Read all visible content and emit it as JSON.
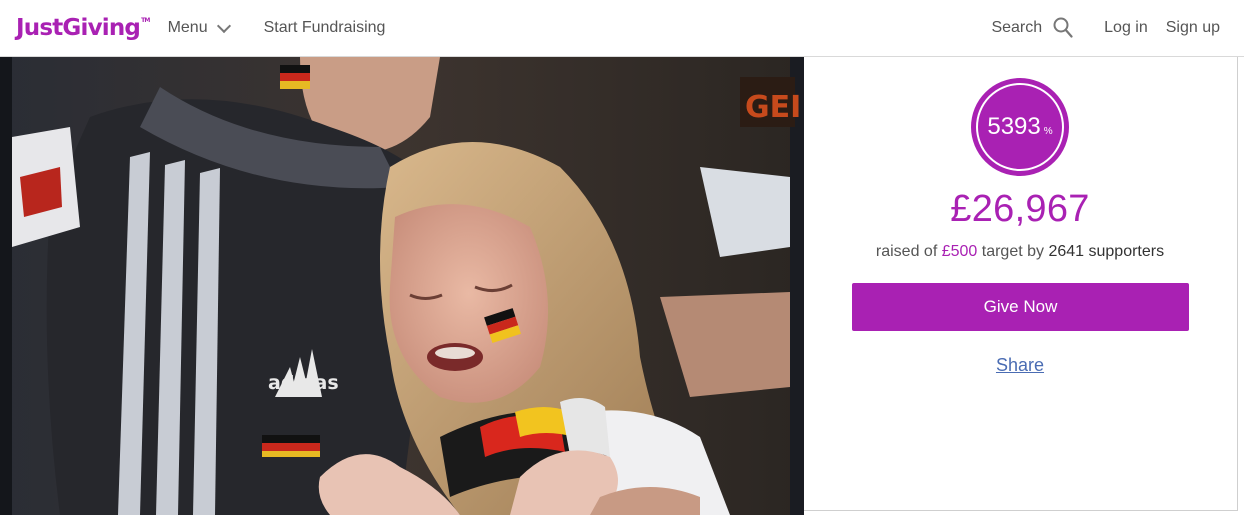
{
  "header": {
    "logo_text": "JustGiving",
    "logo_tm": "TM",
    "menu_label": "Menu",
    "start_fundraising_label": "Start Fundraising",
    "search_label": "Search",
    "login_label": "Log in",
    "signup_label": "Sign up"
  },
  "hero": {
    "shirt_brand_text": "adidas",
    "banner_text": "GEI"
  },
  "fundraiser": {
    "progress_percent": "5393",
    "progress_sign": "%",
    "amount_raised": "£26,967",
    "raised_prefix": "raised of ",
    "target_amount": "£500",
    "target_suffix": " target by ",
    "supporters_text": "2641 supporters",
    "give_now_label": "Give Now",
    "share_label": "Share"
  },
  "colors": {
    "brand_purple": "#a921b3",
    "link_blue": "#4a6cb3",
    "text_grey": "#555555"
  },
  "icons": {
    "menu": "chevron-down-icon",
    "search": "search-icon"
  }
}
